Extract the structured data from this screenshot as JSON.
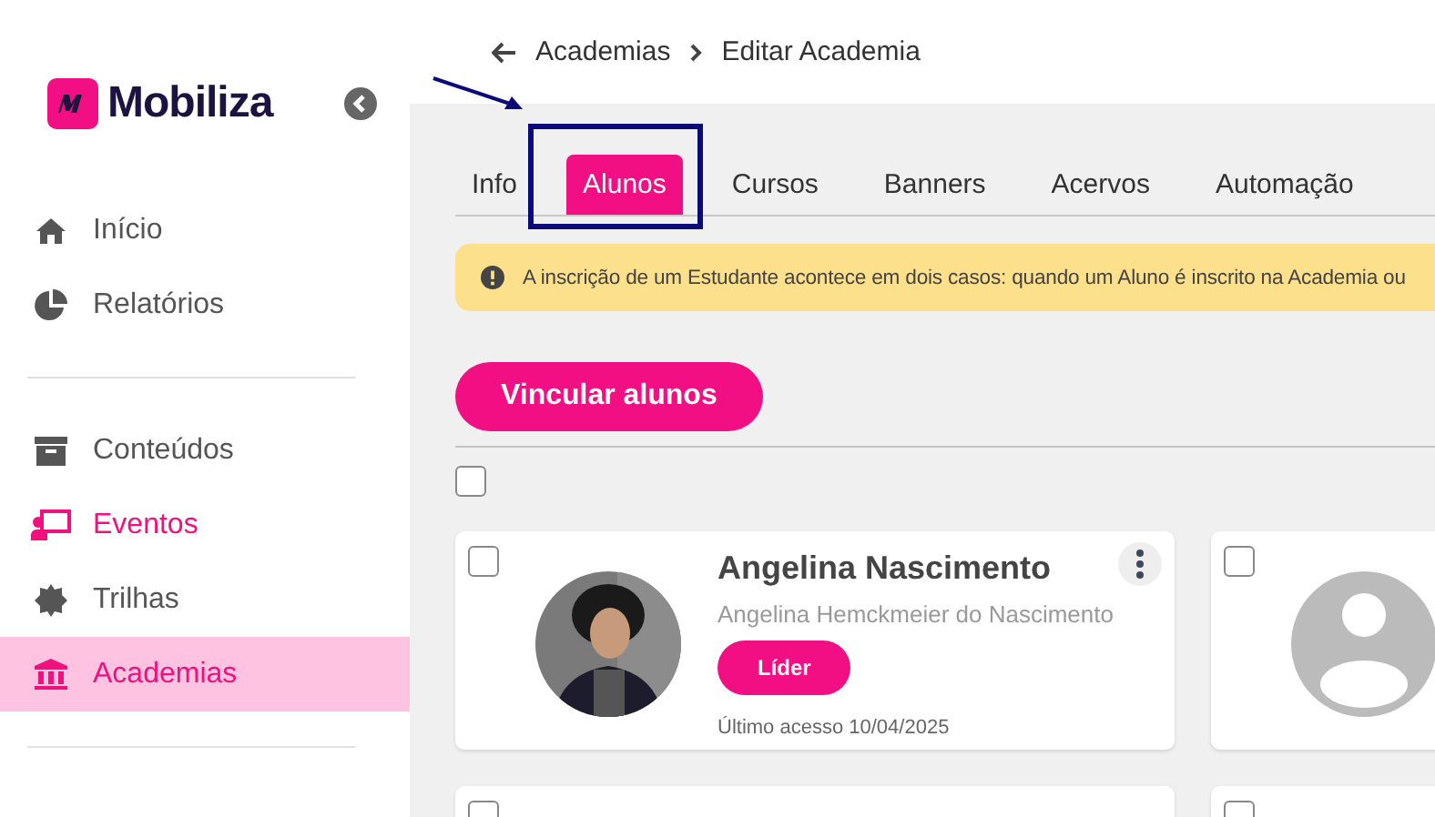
{
  "sidebar": {
    "logo": "Mobiliza",
    "items": [
      {
        "label": "Início",
        "selected": false,
        "color": "#555555"
      },
      {
        "label": "Relatórios",
        "selected": false,
        "color": "#555555"
      },
      {
        "label": "Conteúdos",
        "selected": false,
        "color": "#555555",
        "group_start": true
      },
      {
        "label": "Eventos",
        "selected": false,
        "color": "#f0107e"
      },
      {
        "label": "Trilhas",
        "selected": false,
        "color": "#555555"
      },
      {
        "label": "Academias",
        "selected": true,
        "color": "#f0107e"
      }
    ]
  },
  "breadcrumb": {
    "items": [
      "Academias",
      "Editar Academia"
    ]
  },
  "tabs": [
    {
      "label": "Info",
      "selected": false
    },
    {
      "label": "Alunos",
      "selected": true
    },
    {
      "label": "Cursos",
      "selected": false
    },
    {
      "label": "Banners",
      "selected": false
    },
    {
      "label": "Acervos",
      "selected": false
    },
    {
      "label": "Automação",
      "selected": false
    }
  ],
  "alert": {
    "text": "A inscrição de um Estudante acontece em dois casos: quando um Aluno é inscrito na Academia ou"
  },
  "primary_button": "Vincular alunos",
  "select_all": {
    "checked": false
  },
  "students": [
    {
      "name": "Angelina Nascimento",
      "full_name": "Angelina Hemckmeier do Nascimento",
      "role": "Líder",
      "last_access": "Último acesso 10/04/2025",
      "checked": false
    },
    {
      "kind": "placeholder",
      "checked": false
    },
    {
      "kind": "blank",
      "checked": false
    },
    {
      "kind": "blank",
      "checked": false
    }
  ]
}
